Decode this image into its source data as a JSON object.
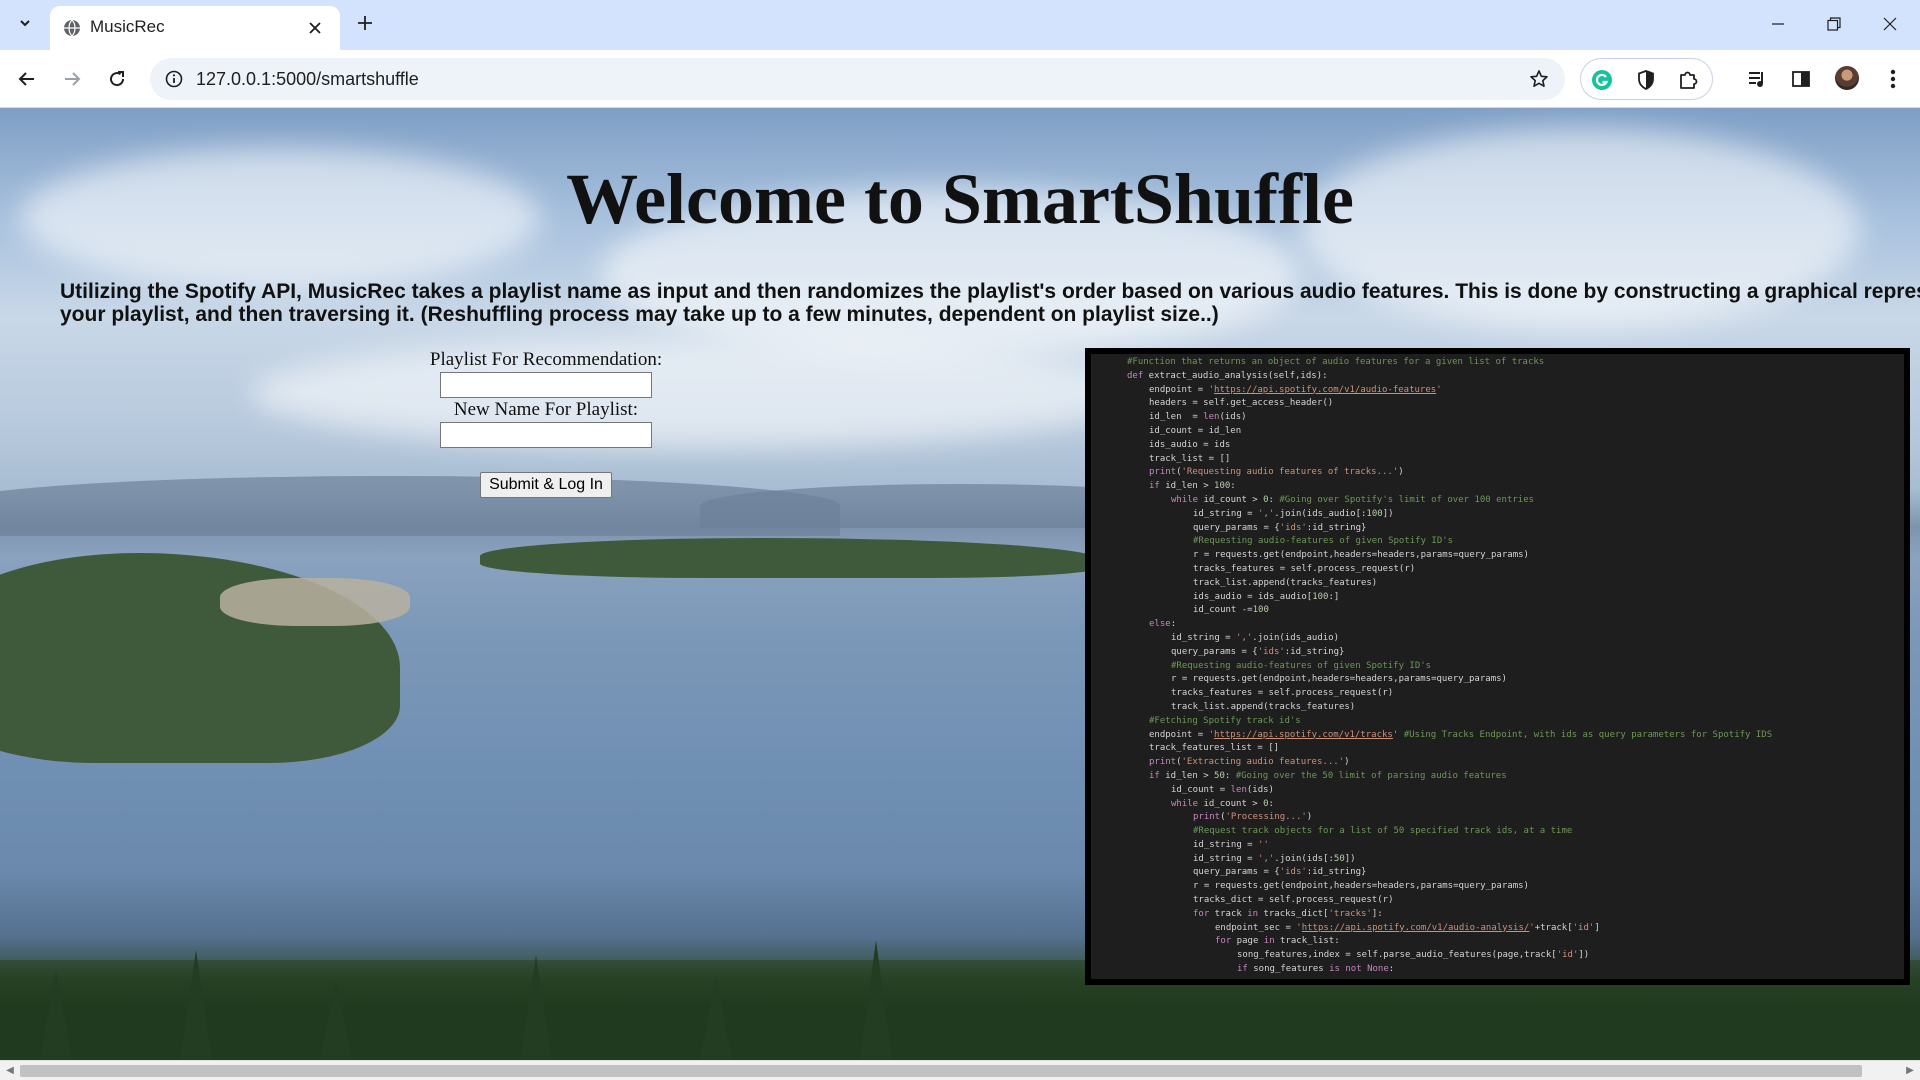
{
  "browser": {
    "tab_title": "MusicRec",
    "url": "127.0.0.1:5000/smartshuffle"
  },
  "icons": {
    "tab_search": "chevron-down-icon",
    "favicon": "globe-icon",
    "tab_close": "close-icon",
    "new_tab": "plus-icon",
    "back": "arrow-left-icon",
    "forward": "arrow-right-icon",
    "reload": "reload-icon",
    "site_info": "info-icon",
    "bookmark": "star-icon",
    "grammarly": "grammarly-icon",
    "privacy": "shield-icon",
    "extensions": "puzzle-icon",
    "media": "media-controls-icon",
    "side_panel": "side-panel-icon",
    "menu": "kebab-menu-icon"
  },
  "colors": {
    "tabstrip": "#d3e3fd",
    "code_bg": "#1e1e1e",
    "grammarly": "#15c39a"
  },
  "page": {
    "title": "Welcome to SmartShuffle",
    "description_line1": "Utilizing the Spotify API, MusicRec takes a playlist name as input and then randomizes the playlist's order based on various audio features. This is done by constructing a graphical representation of",
    "description_line2": "your playlist, and then traversing it. (Reshuffling process may take up to a few minutes, dependent on playlist size..)"
  },
  "form": {
    "playlist_label": "Playlist For Recommendation:",
    "playlist_value": "",
    "new_name_label": "New Name For Playlist:",
    "new_name_value": "",
    "submit_label": "Submit & Log In"
  },
  "code_lines": [
    {
      "indent": 0,
      "text": "#Function that returns an object of audio features for a given list of tracks"
    },
    {
      "indent": 0,
      "text": "def extract_audio_analysis(self,ids):"
    },
    {
      "indent": 1,
      "text": "endpoint = 'https://api.spotify.com/v1/audio-features'"
    },
    {
      "indent": 1,
      "text": "headers = self.get_access_header()"
    },
    {
      "indent": 1,
      "text": "id_len  = len(ids)"
    },
    {
      "indent": 1,
      "text": "id_count = id_len"
    },
    {
      "indent": 1,
      "text": "ids_audio = ids"
    },
    {
      "indent": 1,
      "text": "track_list = []"
    },
    {
      "indent": 1,
      "text": "print('Requesting audio features of tracks...')"
    },
    {
      "indent": 1,
      "text": "if id_len > 100:"
    },
    {
      "indent": 2,
      "text": "while id_count > 0: #Going over Spotify's limit of over 100 entries"
    },
    {
      "indent": 3,
      "text": "id_string = ','.join(ids_audio[:100])"
    },
    {
      "indent": 3,
      "text": "query_params = {'ids':id_string}"
    },
    {
      "indent": 3,
      "text": "#Requesting audio-features of given Spotify ID's"
    },
    {
      "indent": 3,
      "text": "r = requests.get(endpoint,headers=headers,params=query_params)"
    },
    {
      "indent": 3,
      "text": "tracks_features = self.process_request(r)"
    },
    {
      "indent": 3,
      "text": "track_list.append(tracks_features)"
    },
    {
      "indent": 3,
      "text": "ids_audio = ids_audio[100:]"
    },
    {
      "indent": 3,
      "text": "id_count -=100"
    },
    {
      "indent": 1,
      "text": "else:"
    },
    {
      "indent": 2,
      "text": "id_string = ','.join(ids_audio)"
    },
    {
      "indent": 2,
      "text": "query_params = {'ids':id_string}"
    },
    {
      "indent": 2,
      "text": "#Requesting audio-features of given Spotify ID's"
    },
    {
      "indent": 2,
      "text": "r = requests.get(endpoint,headers=headers,params=query_params)"
    },
    {
      "indent": 2,
      "text": "tracks_features = self.process_request(r)"
    },
    {
      "indent": 2,
      "text": "track_list.append(tracks_features)"
    },
    {
      "indent": 1,
      "text": "#Fetching Spotify track id's"
    },
    {
      "indent": 1,
      "text": "endpoint = 'https://api.spotify.com/v1/tracks' #Using Tracks Endpoint, with ids as query parameters for Spotify IDS"
    },
    {
      "indent": 1,
      "text": "track_features_list = []"
    },
    {
      "indent": 1,
      "text": "print('Extracting audio features...')"
    },
    {
      "indent": 1,
      "text": "if id_len > 50: #Going over the 50 limit of parsing audio features"
    },
    {
      "indent": 2,
      "text": "id_count = len(ids)"
    },
    {
      "indent": 2,
      "text": "while id_count > 0:"
    },
    {
      "indent": 3,
      "text": "print('Processing...')"
    },
    {
      "indent": 3,
      "text": "#Request track objects for a list of 50 specified track ids, at a time"
    },
    {
      "indent": 3,
      "text": "id_string = ''"
    },
    {
      "indent": 3,
      "text": "id_string = ','.join(ids[:50])"
    },
    {
      "indent": 3,
      "text": "query_params = {'ids':id_string}"
    },
    {
      "indent": 3,
      "text": "r = requests.get(endpoint,headers=headers,params=query_params)"
    },
    {
      "indent": 3,
      "text": "tracks_dict = self.process_request(r)"
    },
    {
      "indent": 3,
      "text": "for track in tracks_dict['tracks']:"
    },
    {
      "indent": 4,
      "text": "endpoint_sec = 'https://api.spotify.com/v1/audio-analysis/'+track['id']"
    },
    {
      "indent": 4,
      "text": "for page in track_list:"
    },
    {
      "indent": 5,
      "text": "song_features,index = self.parse_audio_features(page,track['id'])"
    },
    {
      "indent": 5,
      "text": "if song_features is not None:"
    }
  ]
}
